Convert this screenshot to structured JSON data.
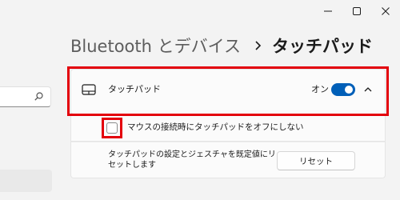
{
  "window": {
    "minimize_icon": "minimize-icon",
    "maximize_icon": "maximize-icon",
    "close_icon": "close-icon"
  },
  "nav": {
    "search_icon": "search-icon"
  },
  "breadcrumb": {
    "parent": "Bluetooth とデバイス",
    "separator_icon": "chevron-right-icon",
    "current": "タッチパッド"
  },
  "touchpad_card": {
    "icon": "touchpad-icon",
    "label": "タッチパッド",
    "toggle_state": "オン",
    "toggle_on": true,
    "expand_icon": "chevron-up-icon",
    "accent_color": "#005fb8"
  },
  "options": {
    "mouse_checkbox_label": "マウスの接続時にタッチパッドをオフにしない",
    "mouse_checkbox_checked": false,
    "reset_description": "タッチパッドの設定とジェスチャを既定値にリセットします",
    "reset_button_label": "リセット"
  },
  "highlight_color": "#e3000b"
}
